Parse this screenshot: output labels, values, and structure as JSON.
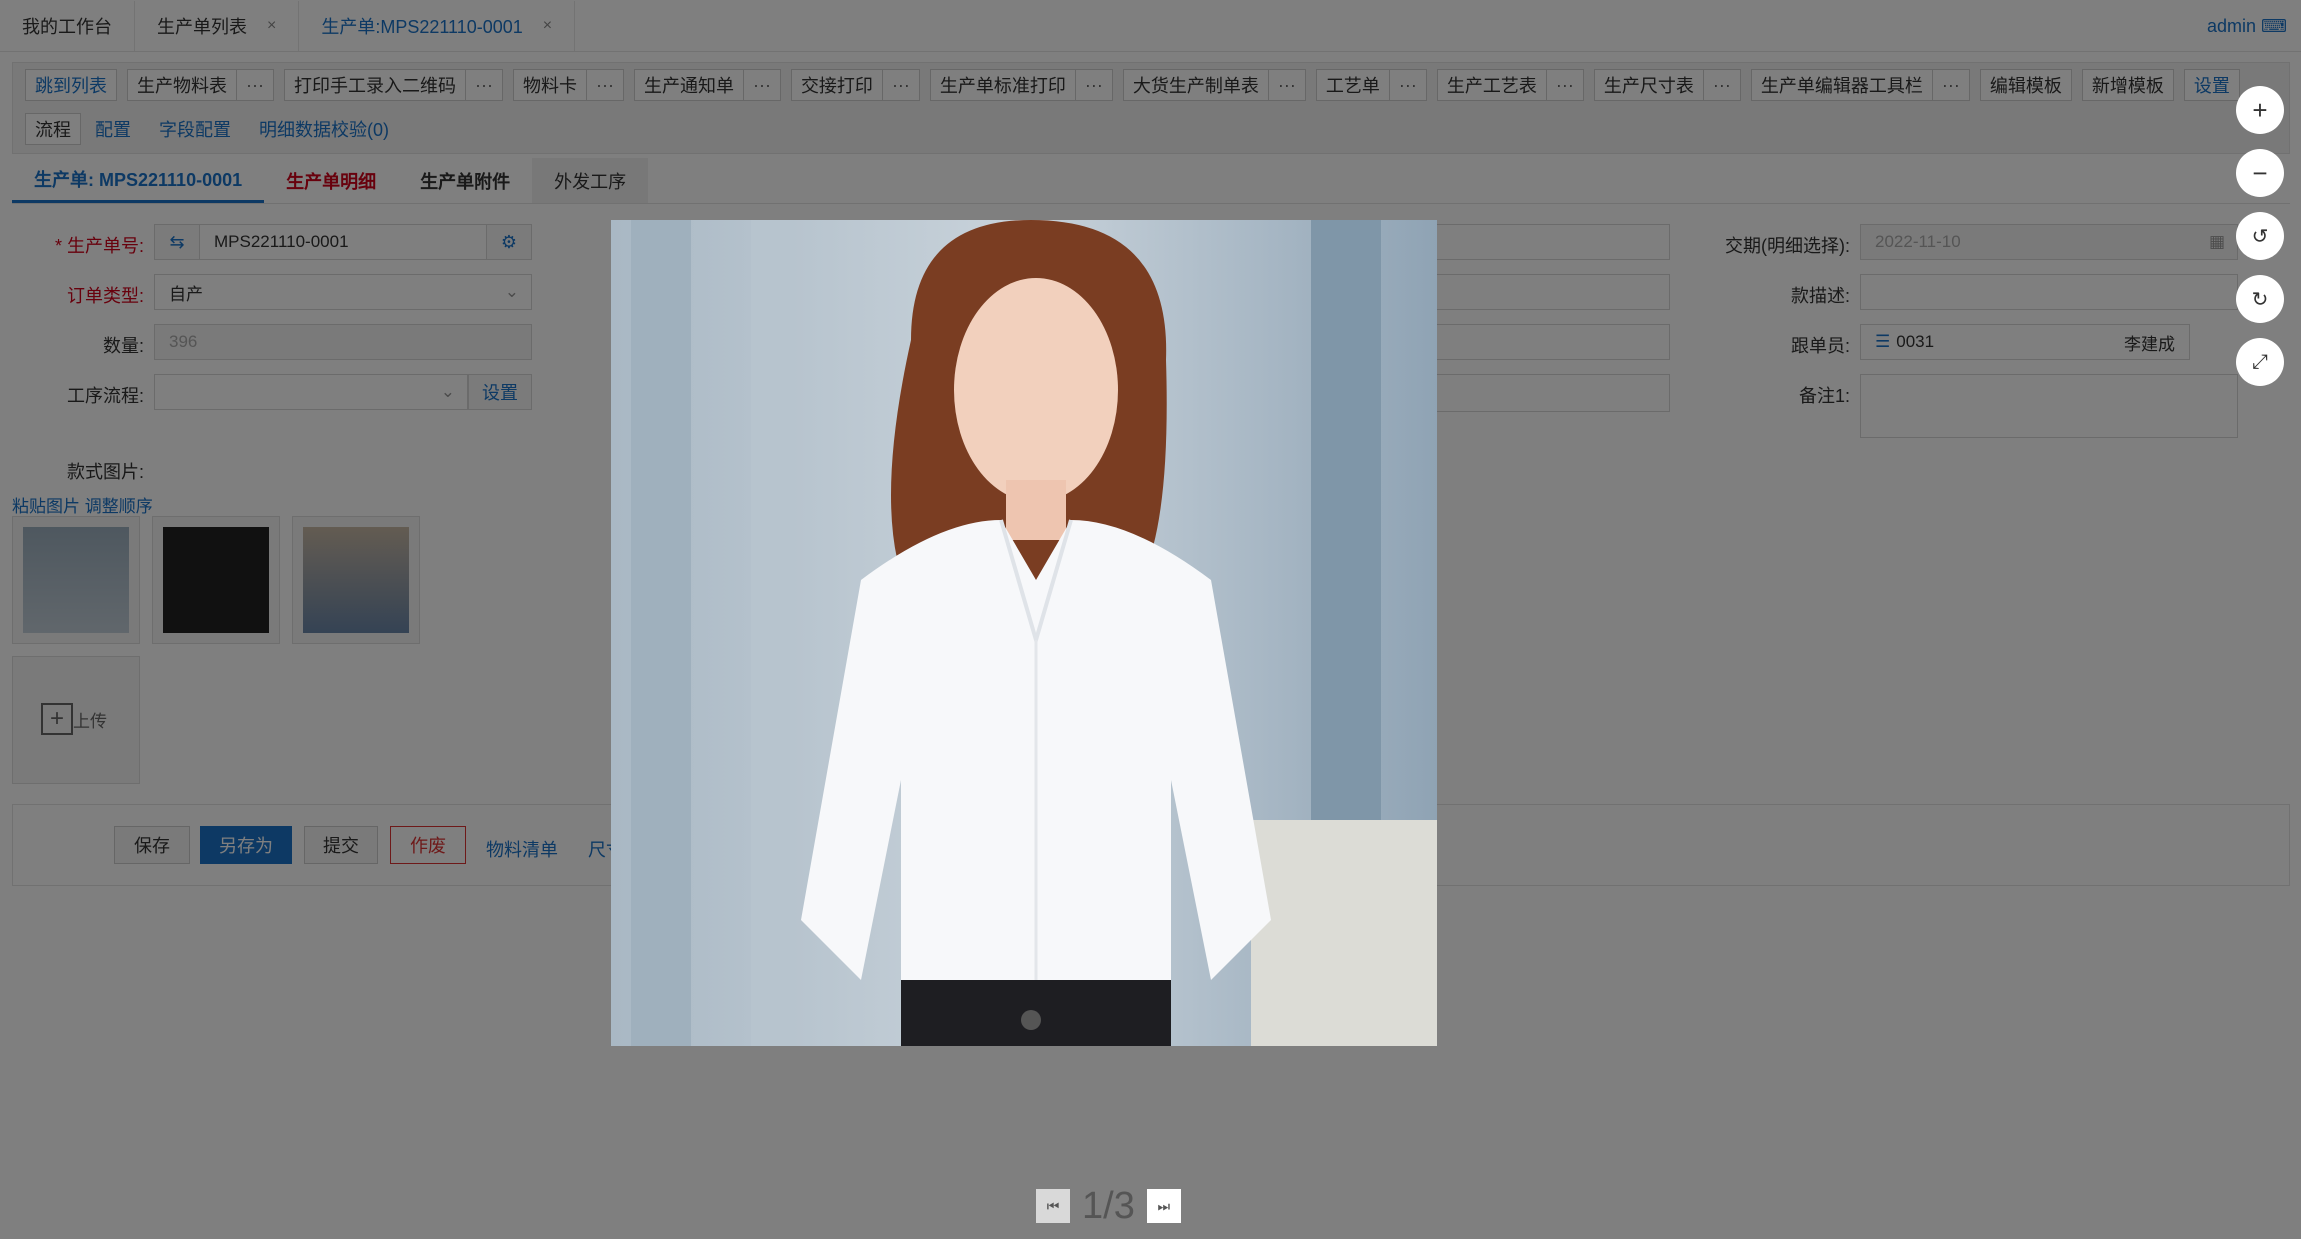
{
  "tabs": [
    {
      "label": "我的工作台",
      "closable": false
    },
    {
      "label": "生产单列表",
      "closable": true
    },
    {
      "label": "生产单:MPS221110-0001",
      "closable": true,
      "active": true
    }
  ],
  "tab_close_glyph": "×",
  "user": {
    "name": "admin",
    "icon": "user-card-icon"
  },
  "toolbar": {
    "row1": [
      {
        "label": "跳到列表",
        "more": false,
        "link": true
      },
      {
        "label": "生产物料表",
        "more": true
      },
      {
        "label": "打印手工录入二维码",
        "more": true
      },
      {
        "label": "物料卡",
        "more": true
      },
      {
        "label": "生产通知单",
        "more": true
      },
      {
        "label": "交接打印",
        "more": true
      },
      {
        "label": "生产单标准打印",
        "more": true
      },
      {
        "label": "大货生产制单表",
        "more": true
      },
      {
        "label": "工艺单",
        "more": true
      },
      {
        "label": "生产工艺表",
        "more": true
      },
      {
        "label": "生产尺寸表",
        "more": true
      },
      {
        "label": "生产单编辑器工具栏",
        "more": true
      },
      {
        "label": "编辑模板",
        "more": false
      },
      {
        "label": "新增模板",
        "more": false
      },
      {
        "label": "设置",
        "more": false,
        "link": true
      }
    ],
    "more_glyph": "···",
    "row2": {
      "flow": "流程",
      "links": [
        "配置",
        "字段配置",
        "明细数据校验(0)"
      ]
    }
  },
  "subtabs": [
    "生产单: MPS221110-0001",
    "生产单明细",
    "生产单附件",
    "外发工序"
  ],
  "form": {
    "order_no": {
      "label": "生产单号:",
      "value": "MPS221110-0001"
    },
    "order_type": {
      "label": "订单类型:",
      "value": "自产"
    },
    "quantity": {
      "label": "数量:",
      "value": "396"
    },
    "process_flow": {
      "label": "工序流程:",
      "value": "",
      "button": "设置"
    },
    "delivery_date": {
      "label": "交期(明细选择):",
      "value": "2022-11-10"
    },
    "style_desc": {
      "label": "款描述:",
      "value": ""
    },
    "follower": {
      "label": "跟单员:",
      "code": "0031",
      "name": "李建成"
    },
    "remark": {
      "label": "备注1:",
      "value": ""
    },
    "images_label": "款式图片:",
    "paste_link": "粘贴图片",
    "reorder_link": "调整顺序",
    "upload_label": "上传"
  },
  "actions": {
    "save": "保存",
    "save_as": "另存为",
    "submit": "提交",
    "void": "作废",
    "bom": "物料清单",
    "size": "尺寸"
  },
  "viewer": {
    "page_text": "1/3",
    "tools": [
      "zoom-in-icon",
      "zoom-out-icon",
      "rotate-left-icon",
      "rotate-right-icon",
      "fullscreen-icon"
    ]
  },
  "colors": {
    "accent": "#1a73c8",
    "required": "#d0021b",
    "mask": "rgba(0,0,0,0.5)"
  }
}
